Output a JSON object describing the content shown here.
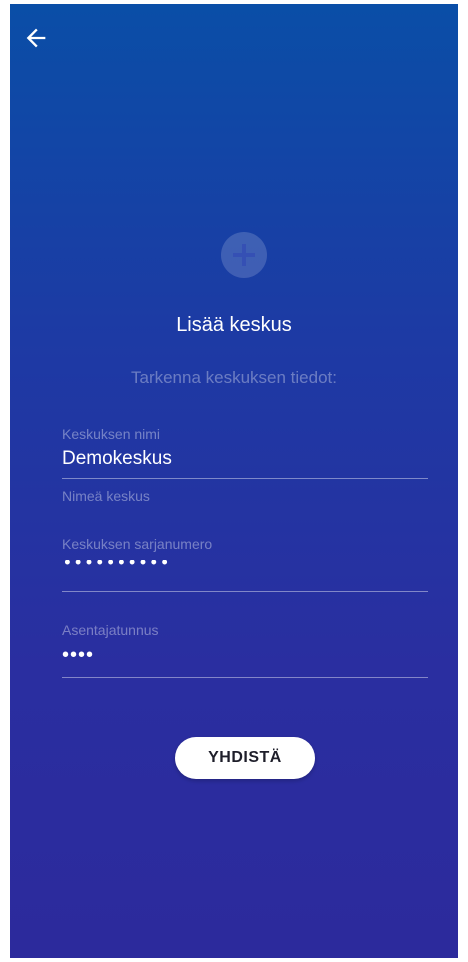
{
  "header": {
    "back_icon": "arrow-left-icon"
  },
  "main": {
    "add_icon": "plus-circle-icon",
    "title": "Lisää keskus",
    "subtitle": "Tarkenna keskuksen tiedot:"
  },
  "form": {
    "name": {
      "label": "Keskuksen nimi",
      "value": "Demokeskus",
      "hint": "Nimeä keskus"
    },
    "serial": {
      "label": "Keskuksen sarjanumero",
      "value": "••••••••••"
    },
    "installer": {
      "label": "Asentajatunnus",
      "value": "••••"
    }
  },
  "actions": {
    "connect_label": "YHDISTÄ"
  },
  "colors": {
    "gradient_top": "#0a4ea7",
    "gradient_bottom": "#2c2a9c",
    "button_bg": "#ffffff"
  }
}
